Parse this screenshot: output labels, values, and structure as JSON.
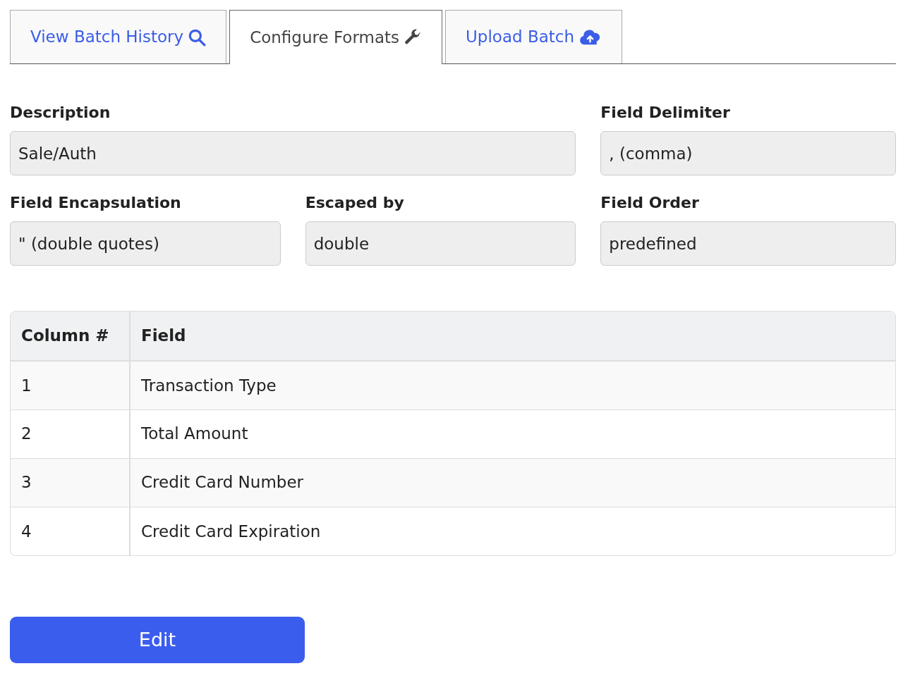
{
  "tabs": [
    {
      "label": "View Batch History",
      "selected": false
    },
    {
      "label": "Configure Formats",
      "selected": true
    },
    {
      "label": "Upload Batch",
      "selected": false
    }
  ],
  "fields": [
    {
      "label": "Description",
      "value": "Sale/Auth"
    },
    {
      "label": "Field Delimiter",
      "value": ", (comma)"
    },
    {
      "label": "Field Encapsulation",
      "value": "\" (double quotes)"
    },
    {
      "label": "Escaped by",
      "value": "double"
    },
    {
      "label": "Field Order",
      "value": "predefined"
    }
  ],
  "table": {
    "columns": [
      "Column #",
      "Field"
    ],
    "rows": [
      [
        "1",
        "Transaction Type"
      ],
      [
        "2",
        "Total Amount"
      ],
      [
        "3",
        "Credit Card Number"
      ],
      [
        "4",
        "Credit Card Expiration"
      ]
    ]
  },
  "buttons": [
    "Edit"
  ]
}
